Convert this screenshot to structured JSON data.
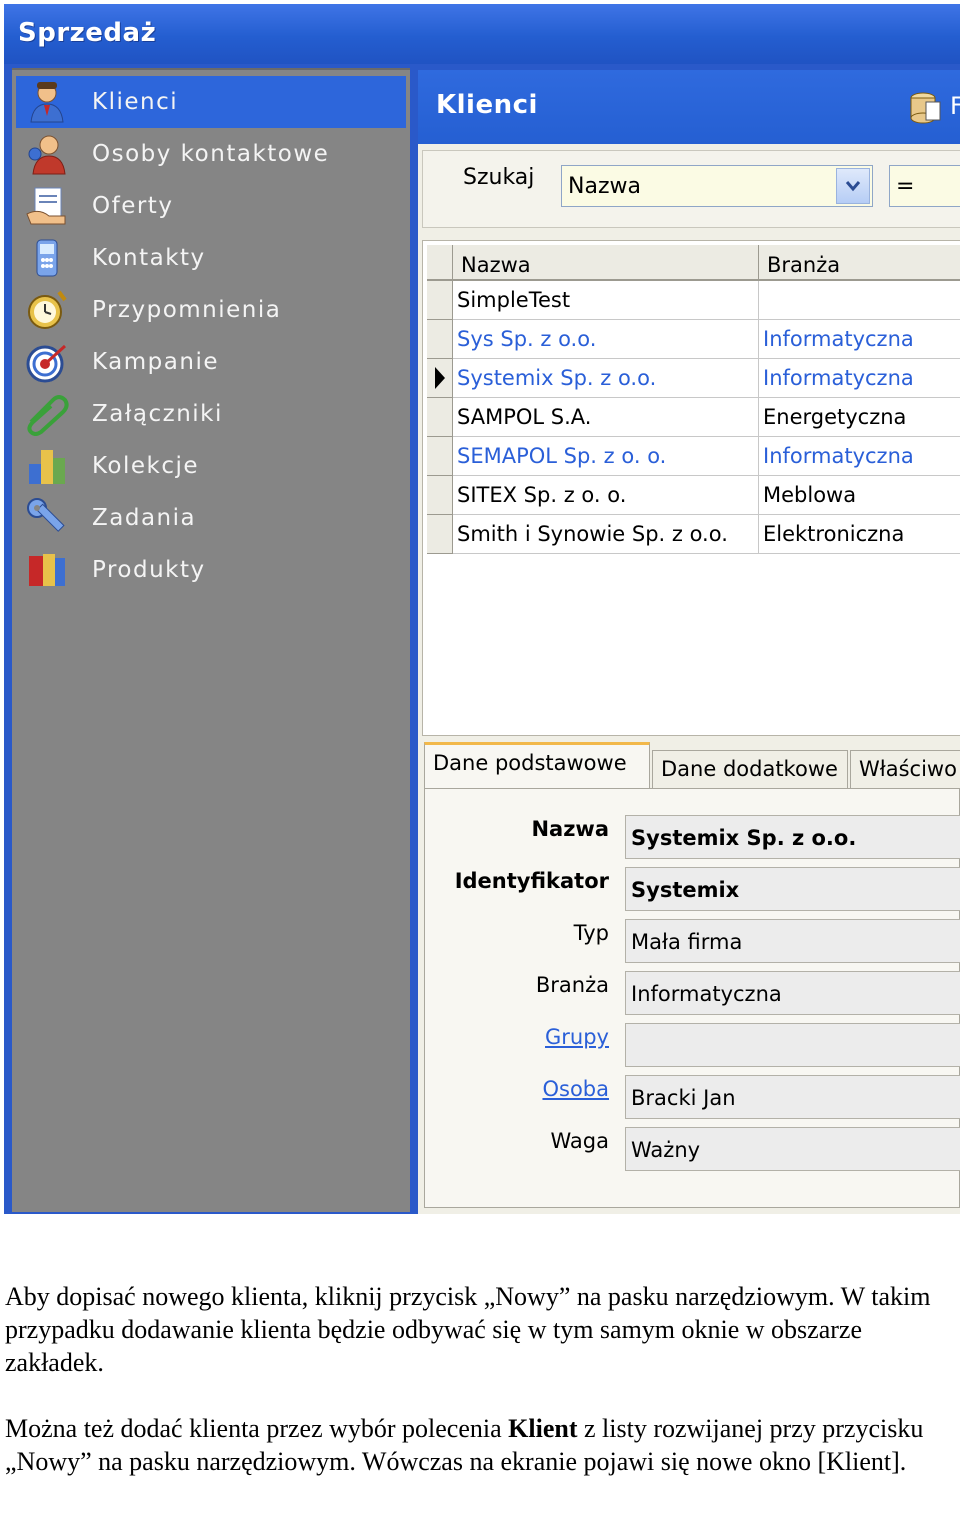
{
  "app": {
    "title": "Sprzedaż"
  },
  "sidebar": {
    "items": [
      {
        "label": "Klienci",
        "icon": "clients-icon",
        "active": true
      },
      {
        "label": "Osoby kontaktowe",
        "icon": "contact-persons-icon"
      },
      {
        "label": "Oferty",
        "icon": "offers-icon"
      },
      {
        "label": "Kontakty",
        "icon": "phone-icon"
      },
      {
        "label": "Przypomnienia",
        "icon": "alarm-clock-icon"
      },
      {
        "label": "Kampanie",
        "icon": "target-icon"
      },
      {
        "label": "Załączniki",
        "icon": "paperclip-icon"
      },
      {
        "label": "Kolekcje",
        "icon": "collections-icon"
      },
      {
        "label": "Zadania",
        "icon": "wrench-icon"
      },
      {
        "label": "Produkty",
        "icon": "products-icon"
      }
    ]
  },
  "main": {
    "title": "Klienci",
    "toolbar_partial_label": "F",
    "search": {
      "label": "Szukaj",
      "field": "Nazwa",
      "operator": "="
    },
    "grid": {
      "columns": [
        "Nazwa",
        "Branża"
      ],
      "rows": [
        {
          "name": "SimpleTest",
          "industry": ""
        },
        {
          "name": "Sys Sp. z o.o.",
          "industry": "Informatyczna"
        },
        {
          "name": "Systemix Sp. z o.o.",
          "industry": "Informatyczna",
          "selected": true
        },
        {
          "name": "SAMPOL S.A.",
          "industry": "Energetyczna"
        },
        {
          "name": "SEMAPOL Sp. z o. o.",
          "industry": "Informatyczna"
        },
        {
          "name": "SITEX Sp. z o. o.",
          "industry": "Meblowa"
        },
        {
          "name": "Smith i Synowie Sp. z o.o.",
          "industry": "Elektroniczna"
        }
      ]
    },
    "tabs": [
      "Dane podstawowe",
      "Dane dodatkowe",
      "Właściwo"
    ],
    "form": {
      "name_label": "Nazwa",
      "name_value": "Systemix Sp. z o.o.",
      "id_label": "Identyfikator",
      "id_value": "Systemix",
      "type_label": "Typ",
      "type_value": "Mała firma",
      "industry_label": "Branża",
      "industry_value": "Informatyczna",
      "groups_label": "Grupy",
      "groups_value": "",
      "person_label": "Osoba",
      "person_value": "Bracki Jan",
      "weight_label": "Waga",
      "weight_value": "Ważny"
    }
  },
  "caption": {
    "p1": "Aby dopisać nowego klienta, kliknij przycisk „Nowy” na pasku narzędziowym. W takim przypadku dodawanie klienta będzie odbywać się w tym samym oknie w obszarze zakładek.",
    "p2_before": "Można też dodać klienta przez  wybór polecenia ",
    "p2_bold": "Klient",
    "p2_after": " z listy rozwijanej przy przycisku „Nowy” na pasku narzędziowym. Wówczas na ekranie pojawi się nowe okno [Klient]."
  },
  "colors": {
    "titlebar": "#245ed0",
    "sidebar": "#858585",
    "active": "#2d66db",
    "link": "#2a5fd8"
  }
}
